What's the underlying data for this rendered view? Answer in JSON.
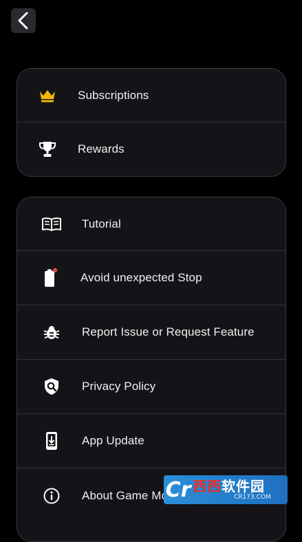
{
  "card_primary": {
    "items": [
      {
        "label": "Subscriptions",
        "icon": "crown-icon",
        "icon_color": "#f5b800"
      },
      {
        "label": "Rewards",
        "icon": "trophy-icon"
      }
    ]
  },
  "card_secondary": {
    "items": [
      {
        "label": "Tutorial",
        "icon": "open-book-icon"
      },
      {
        "label": "Avoid unexpected Stop",
        "icon": "battery-icon",
        "icon_accent": "#e24a4a"
      },
      {
        "label": "Report Issue or Request Feature",
        "icon": "bug-icon"
      },
      {
        "label": "Privacy Policy",
        "icon": "shield-search-icon"
      },
      {
        "label": "App Update",
        "icon": "phone-download-icon"
      },
      {
        "label": "About Game Mode",
        "icon": "info-icon"
      }
    ]
  },
  "watermark": {
    "brand_a": "西西",
    "brand_b": "软件园",
    "domain": "CR173.COM"
  },
  "colors": {
    "background": "#000000",
    "card": "#141418",
    "border": "#3a3a40"
  }
}
